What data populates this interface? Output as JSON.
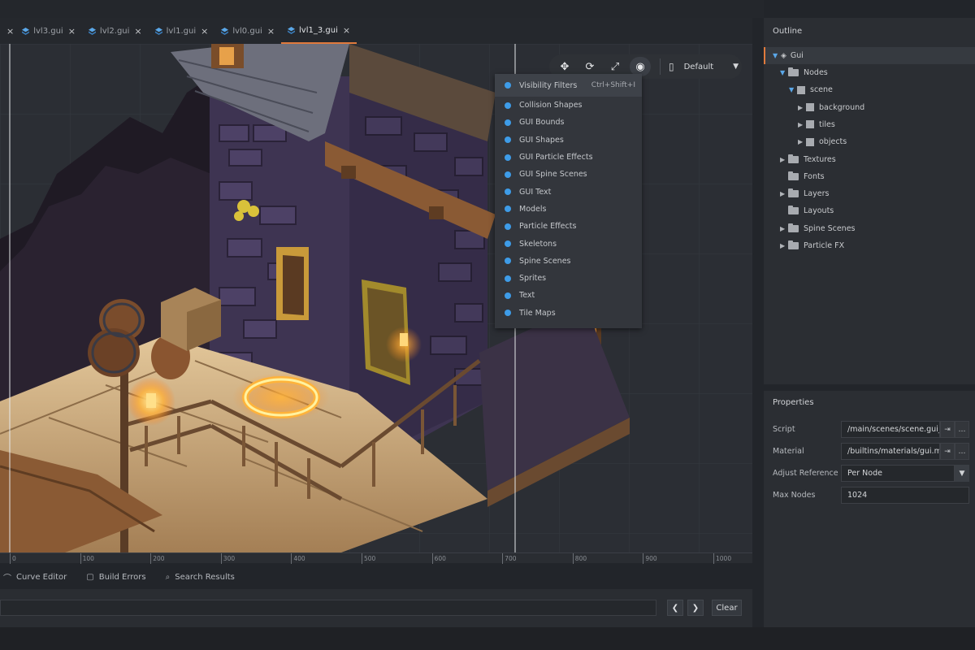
{
  "tabs": [
    {
      "label": "lvl3.gui",
      "active": false
    },
    {
      "label": "lvl2.gui",
      "active": false
    },
    {
      "label": "lvl1.gui",
      "active": false
    },
    {
      "label": "lvl0.gui",
      "active": false
    },
    {
      "label": "lvl1_3.gui",
      "active": true
    }
  ],
  "tab_close_glyph": "×",
  "viewport_toolbar": {
    "move_icon": "✥",
    "rotate_icon": "⟳",
    "scale_icon": "⤢",
    "visibility_icon": "◉",
    "device_icon": "▯",
    "layout_label": "Default",
    "caret": "▼"
  },
  "visibility_menu": {
    "header": {
      "label": "Visibility Filters",
      "shortcut": "Ctrl+Shift+I"
    },
    "items": [
      "Collision Shapes",
      "GUI Bounds",
      "GUI Shapes",
      "GUI Particle Effects",
      "GUI Spine Scenes",
      "GUI Text",
      "Models",
      "Particle Effects",
      "Skeletons",
      "Spine Scenes",
      "Sprites",
      "Text",
      "Tile Maps"
    ],
    "dot_color": "#3e9ce8"
  },
  "ruler": [
    "0",
    "100",
    "200",
    "300",
    "400",
    "500",
    "600",
    "700",
    "800",
    "900",
    "1000"
  ],
  "bottom_tabs": [
    {
      "icon": "curve-icon",
      "glyph": "⌒",
      "label": "Curve Editor"
    },
    {
      "icon": "build-errors-icon",
      "glyph": "▢",
      "label": "Build Errors"
    },
    {
      "icon": "search-icon",
      "glyph": "⌕",
      "label": "Search Results"
    }
  ],
  "console": {
    "prev": "❮",
    "next": "❯",
    "clear_label": "Clear"
  },
  "outline": {
    "title": "Outline",
    "root": "Gui",
    "nodes": [
      {
        "label": "Nodes",
        "depth": 1,
        "kind": "folder",
        "arrow": "▼"
      },
      {
        "label": "scene",
        "depth": 2,
        "kind": "box",
        "arrow": "▼"
      },
      {
        "label": "background",
        "depth": 3,
        "kind": "box",
        "arrow": "▶"
      },
      {
        "label": "tiles",
        "depth": 3,
        "kind": "box",
        "arrow": "▶"
      },
      {
        "label": "objects",
        "depth": 3,
        "kind": "box",
        "arrow": "▶"
      },
      {
        "label": "Textures",
        "depth": 1,
        "kind": "folder",
        "arrow": "▶"
      },
      {
        "label": "Fonts",
        "depth": 1,
        "kind": "folder",
        "arrow": ""
      },
      {
        "label": "Layers",
        "depth": 1,
        "kind": "folder",
        "arrow": "▶"
      },
      {
        "label": "Layouts",
        "depth": 1,
        "kind": "folder",
        "arrow": ""
      },
      {
        "label": "Spine Scenes",
        "depth": 1,
        "kind": "folder",
        "arrow": "▶"
      },
      {
        "label": "Particle FX",
        "depth": 1,
        "kind": "folder",
        "arrow": "▶"
      }
    ],
    "accent": "#e07a3c"
  },
  "properties": {
    "title": "Properties",
    "script_label": "Script",
    "script_value": "/main/scenes/scene.gui_",
    "material_label": "Material",
    "material_value": "/builtins/materials/gui.m",
    "adjust_label": "Adjust Reference",
    "adjust_value": "Per Node",
    "max_nodes_label": "Max Nodes",
    "max_nodes_value": "1024",
    "goto_glyph": "⇥",
    "more_glyph": "…"
  }
}
